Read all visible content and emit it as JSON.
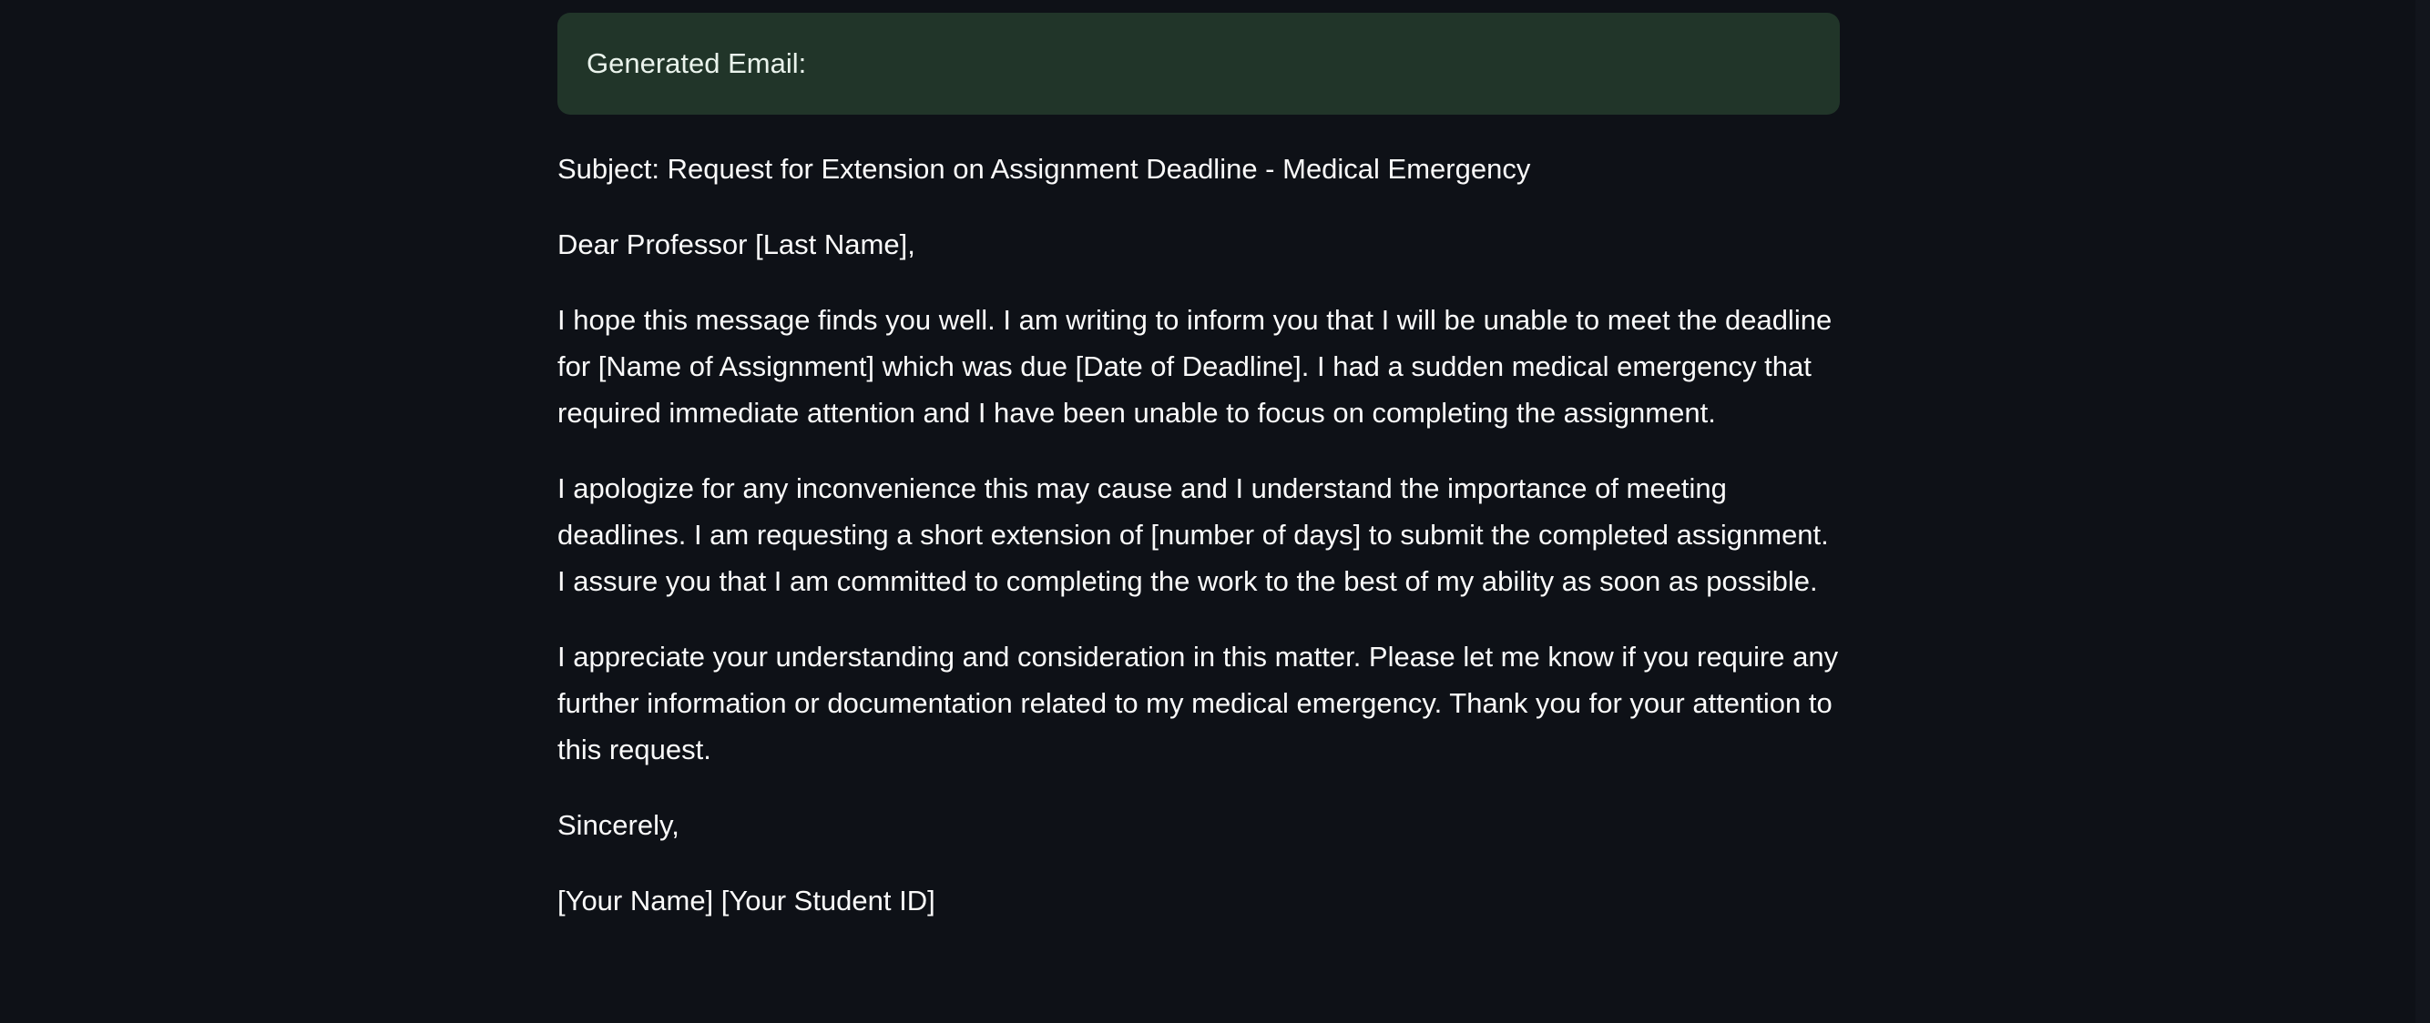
{
  "app": {
    "background_color": "#0e1117",
    "alert_color": "#213529"
  },
  "alert": {
    "label": "Generated Email:"
  },
  "email": {
    "subject": "Subject: Request for Extension on Assignment Deadline - Medical Emergency",
    "greeting": "Dear Professor [Last Name],",
    "paragraphs": [
      "I hope this message finds you well. I am writing to inform you that I will be unable to meet the deadline for [Name of Assignment] which was due [Date of Deadline]. I had a sudden medical emergency that required immediate attention and I have been unable to focus on completing the assignment.",
      "I apologize for any inconvenience this may cause and I understand the importance of meeting deadlines. I am requesting a short extension of [number of days] to submit the completed assignment. I assure you that I am committed to completing the work to the best of my ability as soon as possible.",
      "I appreciate your understanding and consideration in this matter. Please let me know if you require any further information or documentation related to my medical emergency. Thank you for your attention to this request."
    ],
    "closing": "Sincerely,",
    "signature": "[Your Name] [Your Student ID]"
  }
}
